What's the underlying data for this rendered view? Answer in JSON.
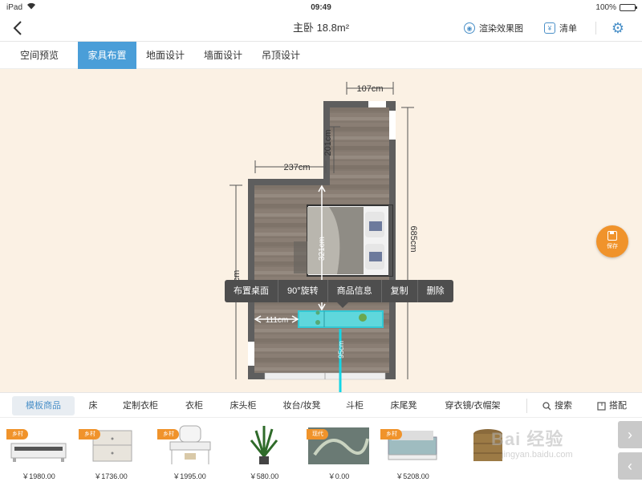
{
  "status_bar": {
    "device": "iPad",
    "time": "09:49",
    "battery": "100%",
    "battery_level": 1.0
  },
  "nav": {
    "title": "主卧 18.8m²",
    "render_label": "渲染效果图",
    "list_label": "清单",
    "icons": {
      "back": "chevron-left-icon",
      "render": "render-icon",
      "list": "list-icon",
      "settings": "gear-icon"
    }
  },
  "tabs": [
    {
      "label": "空间预览",
      "active": false
    },
    {
      "label": "家具布置",
      "active": true
    },
    {
      "label": "地面设计",
      "active": false
    },
    {
      "label": "墙面设计",
      "active": false
    },
    {
      "label": "吊顶设计",
      "active": false
    }
  ],
  "floorplan": {
    "dimensions": {
      "top": "107cm",
      "upper_vertical": "201cm",
      "left_horizontal": "237cm",
      "right_vertical": "685cm",
      "bed_vertical": "321cm",
      "left_vertical": "cm",
      "desk_left": "111cm",
      "desk_bottom": "95cm"
    }
  },
  "context_menu": [
    "布置桌面",
    "90°旋转",
    "商品信息",
    "复制",
    "删除"
  ],
  "save_button": {
    "label": "保存",
    "icon": "save-disk-icon"
  },
  "categories": [
    {
      "label": "模板商品",
      "active": true
    },
    {
      "label": "床",
      "active": false
    },
    {
      "label": "定制衣柜",
      "active": false
    },
    {
      "label": "衣柜",
      "active": false
    },
    {
      "label": "床头柜",
      "active": false
    },
    {
      "label": "妆台/妆凳",
      "active": false
    },
    {
      "label": "斗柜",
      "active": false
    },
    {
      "label": "床尾凳",
      "active": false
    },
    {
      "label": "穿衣镜/衣帽架",
      "active": false
    }
  ],
  "search_label": "搜索",
  "match_label": "搭配",
  "products": [
    {
      "tag": "乡村",
      "price": "￥1980.00",
      "kind": "tv-cabinet"
    },
    {
      "tag": "乡村",
      "price": "￥1736.00",
      "kind": "nightstand"
    },
    {
      "tag": "乡村",
      "price": "￥1995.00",
      "kind": "dressing-table"
    },
    {
      "tag": "",
      "price": "￥580.00",
      "kind": "plant"
    },
    {
      "tag": "现代",
      "price": "￥0.00",
      "kind": "painting"
    },
    {
      "tag": "乡村",
      "price": "￥5208.00",
      "kind": "bed"
    },
    {
      "tag": "",
      "price": "",
      "kind": "basket"
    }
  ],
  "watermark": {
    "text": "Bai 经验",
    "url": "jingyan.baidu.com"
  },
  "colors": {
    "accent": "#4a9ed8",
    "orange": "#f0932b",
    "canvas": "#fbf1e4",
    "wall": "#5e5e5e",
    "selection": "#44e1e8"
  }
}
